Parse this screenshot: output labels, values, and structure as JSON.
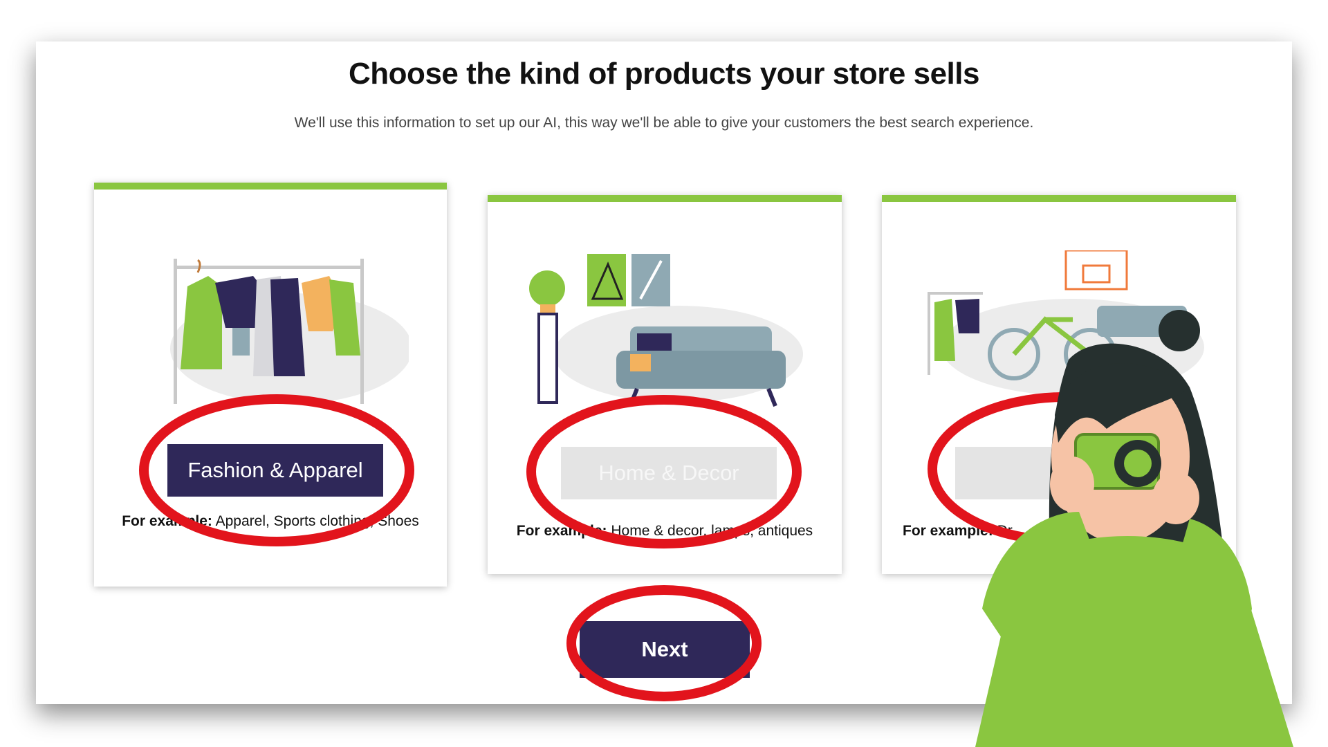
{
  "page": {
    "title": "Choose the kind of products your store sells",
    "subtitle": "We'll use this information to set up our AI, this way we'll be able to give your customers the best search experience."
  },
  "cards": [
    {
      "label": "Fashion & Apparel",
      "example_prefix": "For example:",
      "example_text": "Apparel, Sports clothing, Shoes",
      "selected": true
    },
    {
      "label": "Home & Decor",
      "example_prefix": "For example:",
      "example_text": "Home & decor, lamps, antiques",
      "selected": false
    },
    {
      "label": "",
      "example_prefix": "For example:",
      "example_text": "Dr",
      "selected": false
    }
  ],
  "next_button": {
    "label": "Next"
  },
  "colors": {
    "accent_green": "#8ac640",
    "primary_navy": "#2f2859",
    "annotation_red": "#e2141c"
  }
}
